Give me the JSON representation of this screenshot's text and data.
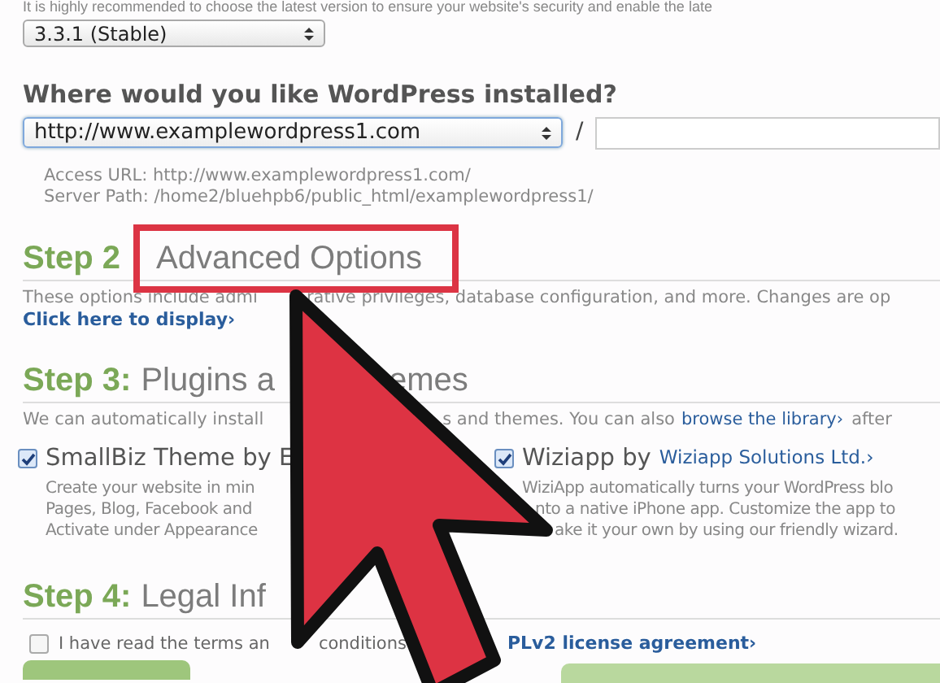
{
  "intro_text": "It is highly recommended to choose the latest version to ensure your website's security and enable the late",
  "version_select": {
    "value": "3.3.1 (Stable)"
  },
  "install_location": {
    "heading": "Where would you like WordPress installed?",
    "domain_select": {
      "value": "http://www.examplewordpress1.com"
    },
    "separator": "/",
    "access_url": "Access URL: http://www.examplewordpress1.com/",
    "server_path": "Server Path: /home2/bluehpb6/public_html/examplewordpress1/"
  },
  "step2": {
    "label": "Step 2",
    "title": "Advanced Options",
    "highlighted": true,
    "description": [
      "These options include admi",
      "rative privileges, database configuration, and more. Changes are op"
    ],
    "link": "Click here to display›"
  },
  "step3": {
    "label": "Step 3:",
    "title": [
      "Plugins a",
      "emes"
    ],
    "description": [
      "We can automatically install",
      "s and themes. You can also"
    ],
    "link": "browse the library›",
    "description_end": "after",
    "items": [
      {
        "title": "SmallBiz Theme by E",
        "checked": true,
        "lines": [
          "Create your website in min",
          "Pages, Blog, Facebook and",
          "Activate under Appearance"
        ]
      },
      {
        "title": "Wiziapp by",
        "author": "Wiziapp Solutions Ltd.›",
        "checked": true,
        "lines": [
          "WiziApp automatically turns your WordPress blo",
          "nto a native iPhone app. Customize the app to",
          "ake it your own by using our friendly wizard."
        ]
      }
    ]
  },
  "step4": {
    "label": "Step 4:",
    "title": "Legal Inf",
    "terms": {
      "checked": false,
      "text": [
        "I have read the terms an",
        "conditions"
      ],
      "link": "PLv2 license agreement›"
    }
  }
}
